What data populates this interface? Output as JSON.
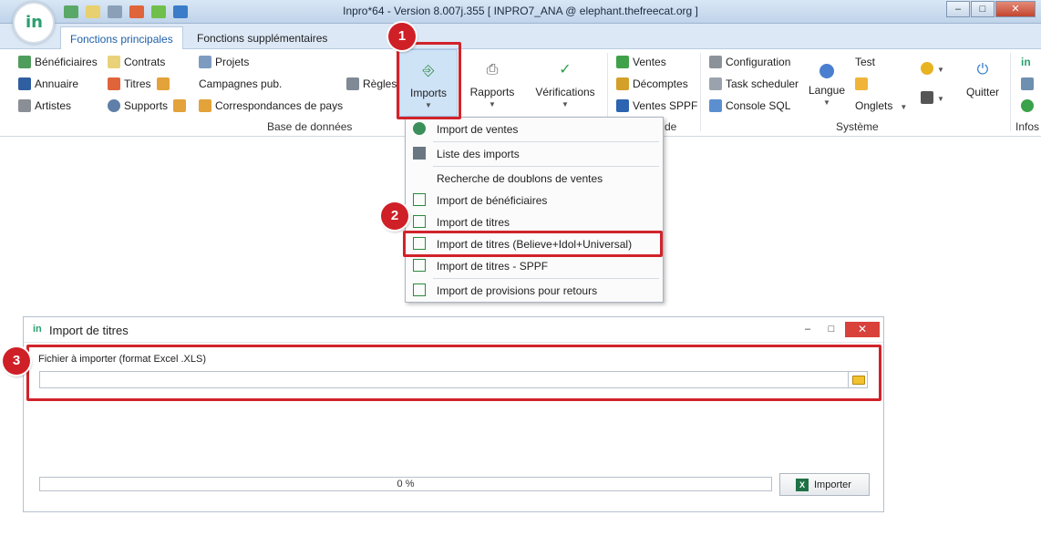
{
  "window": {
    "title": "Inpro*64 - Version 8.007j.355  [ INPRO7_ANA @ elephant.thefreecat.org ]",
    "logo": "in"
  },
  "tabs": [
    "Fonctions principales",
    "Fonctions supplémentaires"
  ],
  "ribbon": {
    "base_donnees": {
      "items": [
        "Bénéficiaires",
        "Contrats",
        "Projets",
        "Annuaire",
        "Titres",
        "Campagnes pub.",
        "Artistes",
        "Supports",
        "Correspondances de pays",
        "Règles"
      ],
      "group_label": "Base de données"
    },
    "big_buttons": {
      "imports": "Imports",
      "rapports": "Rapports",
      "verifications": "Vérifications"
    },
    "ventes": {
      "items": [
        "Ventes",
        "Décomptes",
        "Ventes SPPF"
      ],
      "group_label_fragment": "de"
    },
    "systeme": {
      "items": [
        "Configuration",
        "Task scheduler",
        "Console SQL"
      ],
      "langue": "Langue",
      "test": "Test",
      "onglets": "Onglets",
      "quitter": "Quitter",
      "group_label": "Système"
    },
    "infos": {
      "logo": "in",
      "group_label": "Infos"
    }
  },
  "imports_menu": {
    "items": [
      "Import de ventes",
      "Liste des imports",
      "Recherche de doublons de ventes",
      "Import de bénéficiaires",
      "Import de titres",
      "Import de titres (Believe+Idol+Universal)",
      "Import de titres - SPPF",
      "Import de provisions pour retours"
    ]
  },
  "callouts": [
    "1",
    "2",
    "3"
  ],
  "dialog": {
    "logo": "in",
    "title": "Import de titres",
    "file_label": "Fichier à importer (format Excel .XLS)",
    "file_value": "",
    "progress_text": "0 %",
    "progress_value": 0,
    "import_button": "Importer",
    "excel_icon_letter": "X"
  }
}
